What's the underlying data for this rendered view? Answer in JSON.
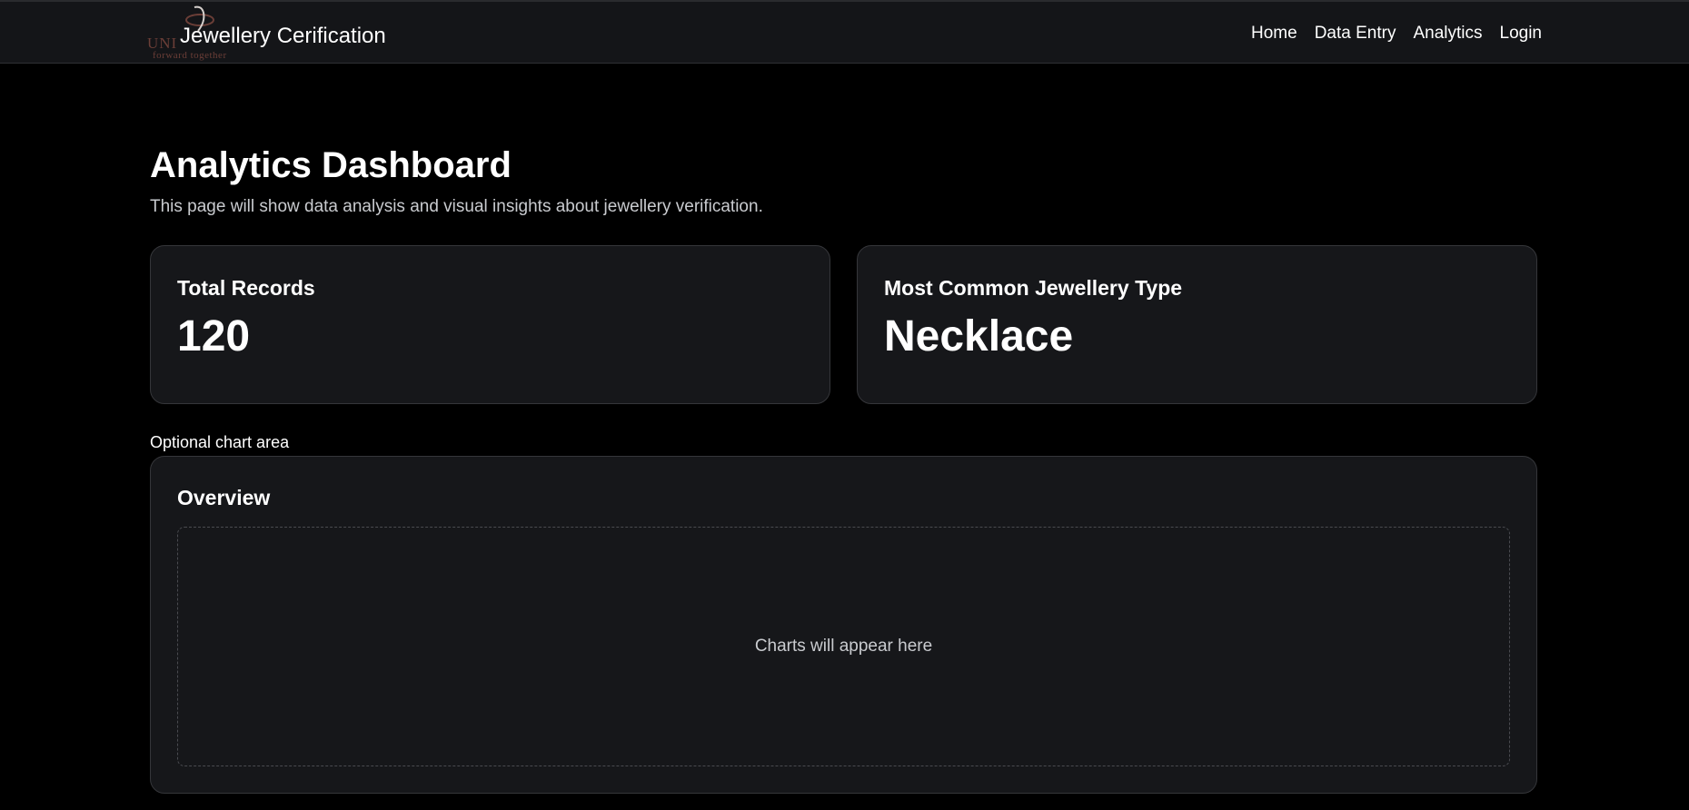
{
  "nav": {
    "logo_text": "UNI",
    "logo_tagline": "forward together",
    "brand": "Jewellery Cerification",
    "links": [
      "Home",
      "Data Entry",
      "Analytics",
      "Login"
    ]
  },
  "header": {
    "title": "Analytics Dashboard",
    "description": "This page will show data analysis and visual insights about jewellery verification."
  },
  "cards": [
    {
      "label": "Total Records",
      "value": "120"
    },
    {
      "label": "Most Common Jewellery Type",
      "value": "Necklace"
    }
  ],
  "chart_section": {
    "caption": "Optional chart area",
    "title": "Overview",
    "placeholder": "Charts will appear here"
  },
  "colors": {
    "background": "#000000",
    "navbar": "#141518",
    "card": "#16171a",
    "logo": "#6b3e37"
  }
}
